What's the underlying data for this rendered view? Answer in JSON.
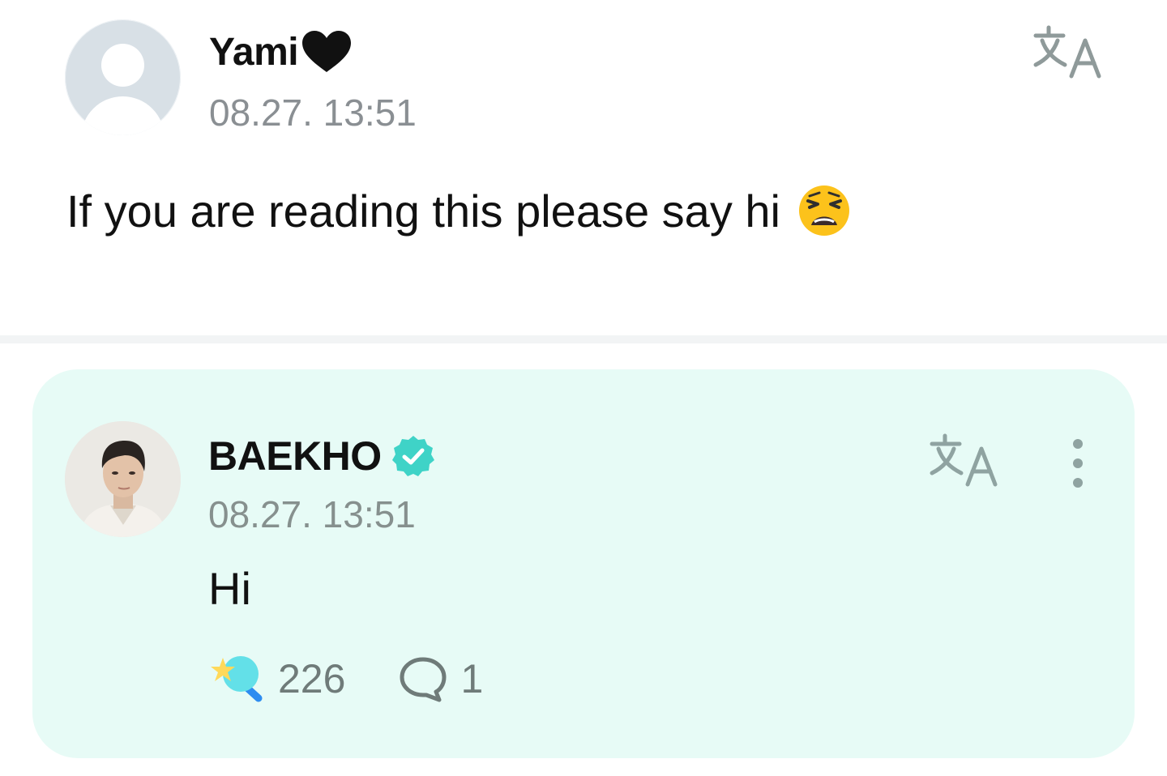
{
  "post": {
    "author": "Yami",
    "timestamp": "08.27. 13:51",
    "text": "If you are reading this please say hi",
    "icons": {
      "avatar": "default-avatar-icon",
      "name_suffix": "black-heart-icon",
      "text_suffix": "weary-face-emoji-icon",
      "translate": "translate-icon"
    }
  },
  "reply": {
    "author": "BAEKHO",
    "timestamp": "08.27. 13:51",
    "text": "Hi",
    "boost_count": "226",
    "comment_count": "1",
    "icons": {
      "verified": "verified-badge-icon",
      "translate": "translate-icon",
      "more": "more-vertical-icon",
      "boost": "star-wand-icon",
      "comment": "comment-bubble-icon"
    }
  },
  "colors": {
    "reply_background": "#e7fbf6",
    "verified_badge": "#3fd3c7",
    "muted_text": "#8a8f93",
    "translate_icon": "#8fa3a1"
  }
}
